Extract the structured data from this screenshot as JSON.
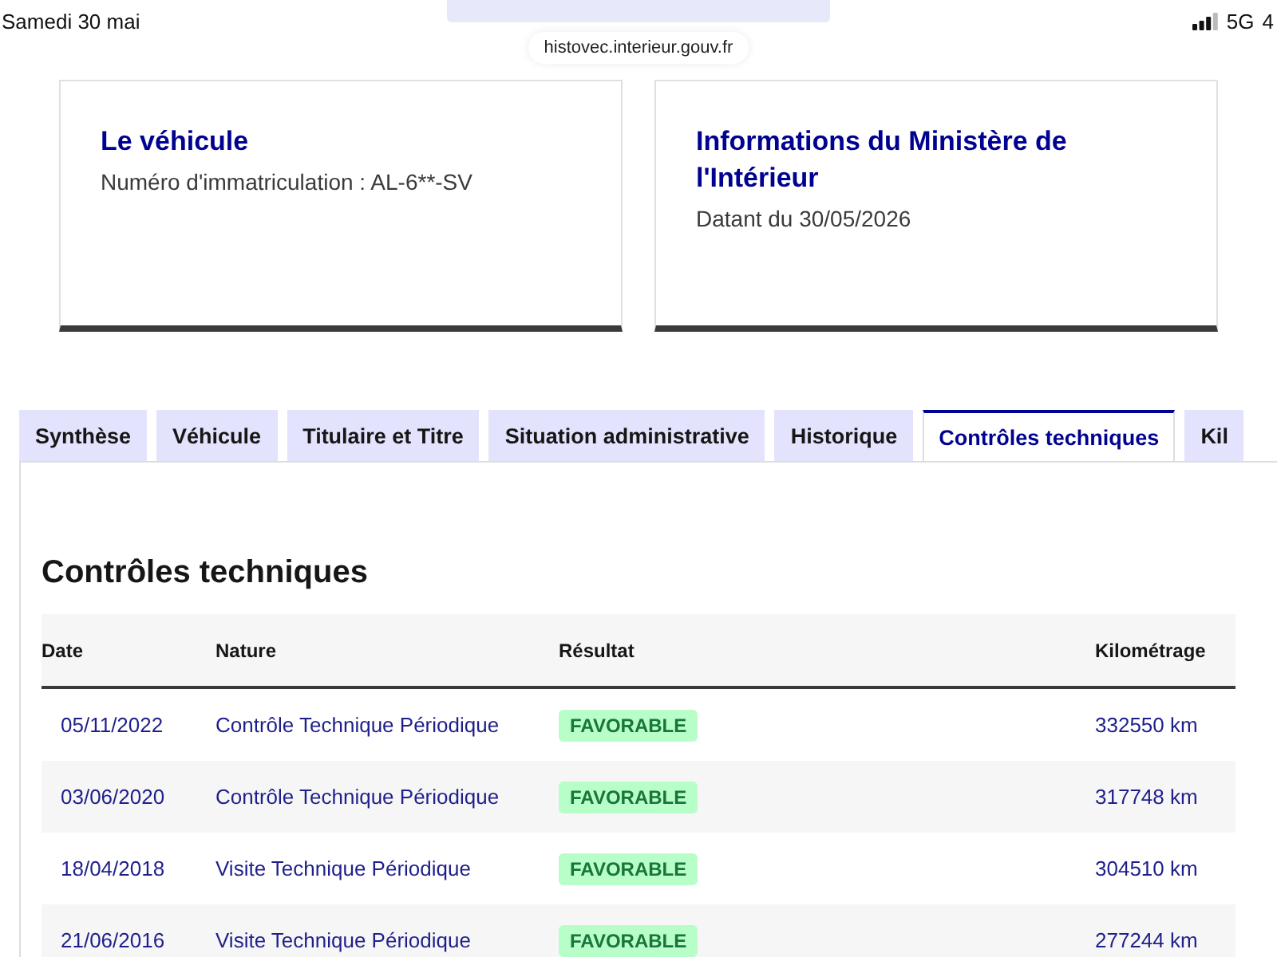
{
  "status_bar": {
    "date": "Samedi 30 mai",
    "network": "5G",
    "battery": "4"
  },
  "address_bar": {
    "url": "histovec.interieur.gouv.fr"
  },
  "cards": [
    {
      "title": "Le véhicule",
      "text": "Numéro d'immatriculation : AL-6**-SV"
    },
    {
      "title": "Informations du Ministère de l'Intérieur",
      "text": "Datant du 30/05/2026"
    }
  ],
  "tabs": [
    {
      "label": "Synthèse",
      "selected": false
    },
    {
      "label": "Véhicule",
      "selected": false
    },
    {
      "label": "Titulaire et Titre",
      "selected": false
    },
    {
      "label": "Situation administrative",
      "selected": false
    },
    {
      "label": "Historique",
      "selected": false
    },
    {
      "label": "Contrôles techniques",
      "selected": true
    },
    {
      "label": "Kil",
      "selected": false
    }
  ],
  "panel": {
    "title": "Contrôles techniques",
    "table": {
      "columns": [
        "Date",
        "Nature",
        "Résultat",
        "Kilométrage"
      ],
      "rows": [
        {
          "date": "05/11/2022",
          "nature": "Contrôle Technique Périodique",
          "result": "FAVORABLE",
          "mileage": "332550 km"
        },
        {
          "date": "03/06/2020",
          "nature": "Contrôle Technique Périodique",
          "result": "FAVORABLE",
          "mileage": "317748 km"
        },
        {
          "date": "18/04/2018",
          "nature": "Visite Technique Périodique",
          "result": "FAVORABLE",
          "mileage": "304510 km"
        },
        {
          "date": "21/06/2016",
          "nature": "Visite Technique Périodique",
          "result": "FAVORABLE",
          "mileage": "277244 km"
        }
      ]
    }
  }
}
